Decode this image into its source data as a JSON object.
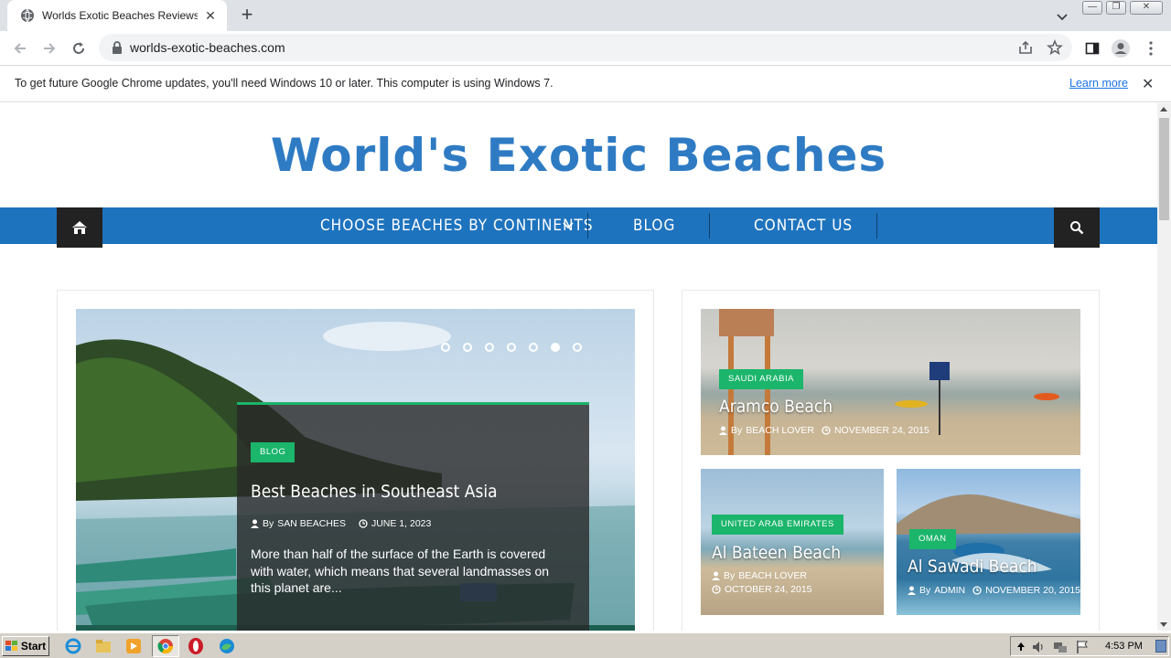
{
  "browser": {
    "tab_title": "Worlds Exotic Beaches Reviews, Tra",
    "url": "worlds-exotic-beaches.com",
    "infobar_text": "To get future Google Chrome updates, you'll need Windows 10 or later. This computer is using Windows 7.",
    "infobar_link": "Learn more"
  },
  "site": {
    "logo": "World's Exotic Beaches",
    "nav": [
      {
        "label": "CHOOSE BEACHES BY CONTINENTS"
      },
      {
        "label": "BLOG"
      },
      {
        "label": "CONTACT US"
      }
    ]
  },
  "featured": {
    "category": "BLOG",
    "title": "Best Beaches in Southeast Asia",
    "author": "SAN BEACHES",
    "by": "By",
    "date": "JUNE 1, 2023",
    "excerpt": "More than half of the surface of the Earth is covered with water, which means that several landmasses on this planet are...",
    "slider_dots": 7,
    "active_dot": 6
  },
  "side_posts": [
    {
      "category": "SAUDI ARABIA",
      "title": "Aramco Beach",
      "by": "By",
      "author": "BEACH LOVER",
      "date": "NOVEMBER 24, 2015"
    },
    {
      "category": "UNITED ARAB EMIRATES",
      "title": "Al Bateen Beach",
      "by": "By",
      "author": "BEACH LOVER",
      "date": "OCTOBER 24, 2015"
    },
    {
      "category": "OMAN",
      "title": "Al Sawadi Beach",
      "by": "By",
      "author": "ADMIN",
      "date": "NOVEMBER 20, 2015"
    }
  ],
  "taskbar": {
    "start_label": "Start",
    "clock": "4:53 PM"
  },
  "colors": {
    "nav_blue": "#1e73be",
    "accent_green": "#1bb56b",
    "logo_blue": "#2e7bc4"
  }
}
